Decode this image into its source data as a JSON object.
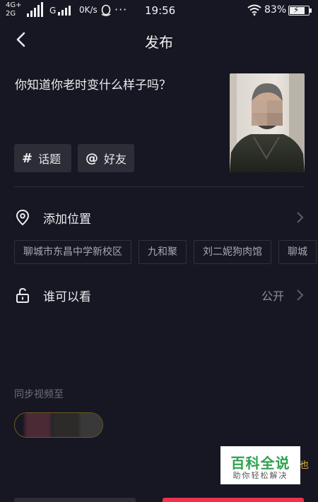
{
  "status_bar": {
    "network_top": "4G+",
    "network_bottom": "2G",
    "network_g": "G",
    "speed": "0K/s",
    "more": "···",
    "time": "19:56",
    "battery": "83%",
    "battery_level": 0.83
  },
  "nav": {
    "title": "发布",
    "back_icon": "chevron-left-icon"
  },
  "post": {
    "caption": "你知道你老时变什么样子吗？",
    "chips": [
      {
        "symbol": "#",
        "label": "话题",
        "icon": "hashtag-icon"
      },
      {
        "symbol": "@",
        "label": "好友",
        "icon": "at-icon"
      }
    ]
  },
  "location": {
    "label": "添加位置",
    "icon": "location-pin-icon",
    "tags": [
      "聊城市东昌中学新校区",
      "九和聚",
      "刘二妮狗肉馆",
      "聊城"
    ]
  },
  "visibility": {
    "label": "谁可以看",
    "value": "公开",
    "icon": "unlock-icon"
  },
  "sync": {
    "label": "同步视频至"
  },
  "yellow_fragment": "也",
  "watermark": {
    "title": "百科全说",
    "subtitle": "助你轻松解决"
  },
  "colors": {
    "background": "#161722",
    "chip": "#2c2d37",
    "publish": "#f0304f",
    "watermark_green": "#2da24c"
  }
}
